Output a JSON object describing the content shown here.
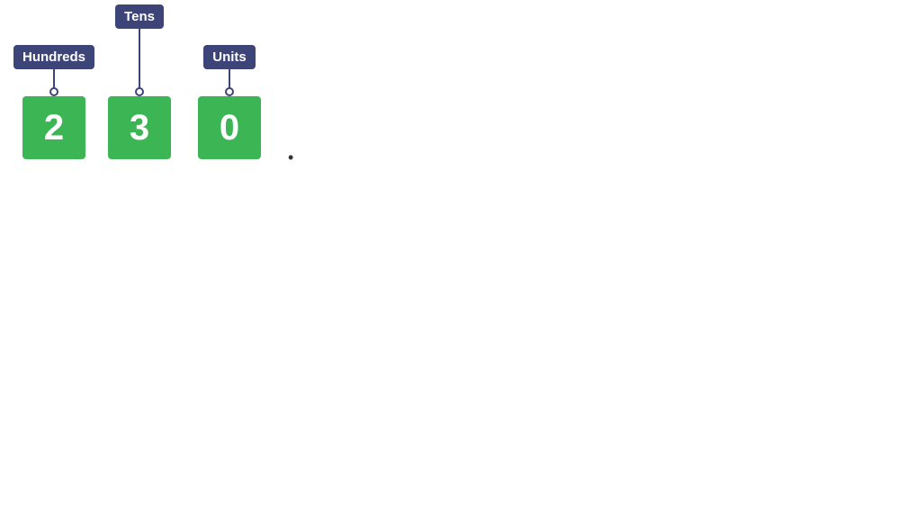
{
  "columns": [
    {
      "id": "hundreds",
      "label": "Hundreds",
      "digit": "2",
      "label_top_offset": 45
    },
    {
      "id": "tens",
      "label": "Tens",
      "digit": "3",
      "label_top_offset": 0
    },
    {
      "id": "units",
      "label": "Units",
      "digit": "0",
      "label_top_offset": 45
    }
  ],
  "bullet": "•",
  "colors": {
    "label_bg": "#3d4477",
    "digit_bg": "#3cb554",
    "connector": "#3d4477",
    "text": "#ffffff",
    "bullet": "#333333"
  }
}
